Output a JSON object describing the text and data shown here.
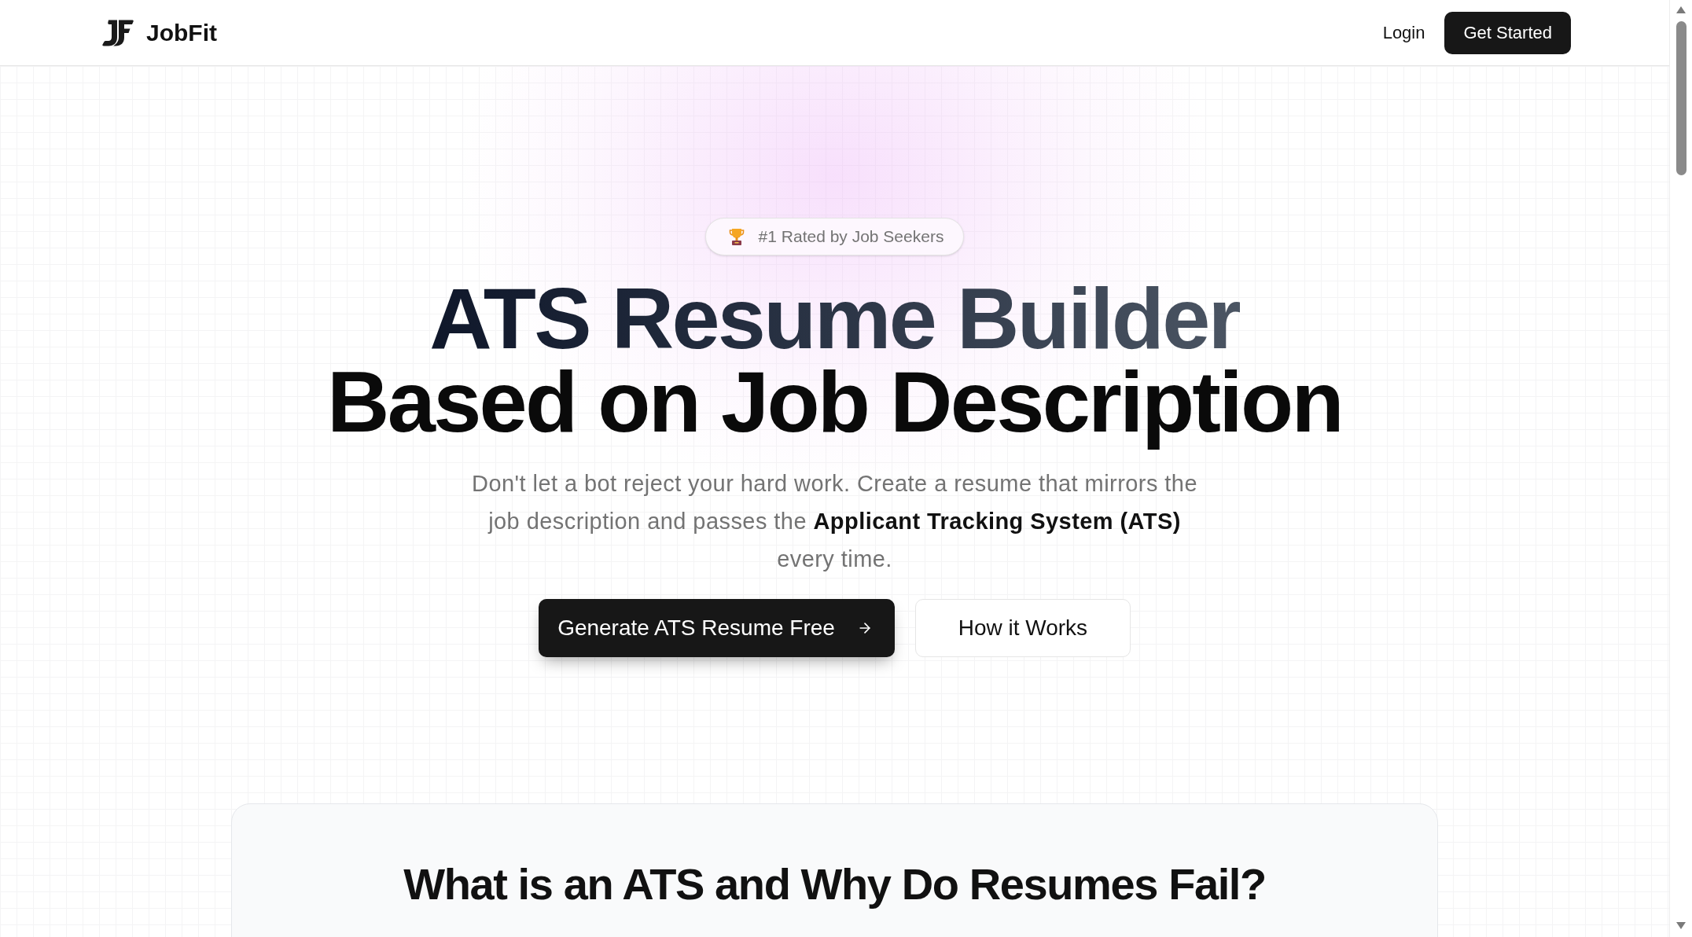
{
  "header": {
    "brand": "JobFit",
    "nav": [
      {
        "kind": "link",
        "label": "Login"
      },
      {
        "kind": "button",
        "label": "Get Started"
      }
    ]
  },
  "hero": {
    "badge": "#1 Rated by Job Seekers",
    "title_lines": [
      {
        "kind": "gradient",
        "text": "ATS Resume Builder"
      },
      {
        "kind": "plain",
        "text": "Based on Job Description"
      }
    ],
    "subtitle": "Don't let a bot reject your hard work. Create a resume that mirrors the job description and passes the **Applicant Tracking System (ATS)** every time.",
    "buttons": [
      {
        "kind": "primary",
        "label": "Generate ATS Resume Free"
      },
      {
        "kind": "secondary",
        "label": "How it Works"
      }
    ]
  },
  "info_card": {
    "title": "What is an ATS and Why Do Resumes Fail?"
  }
}
